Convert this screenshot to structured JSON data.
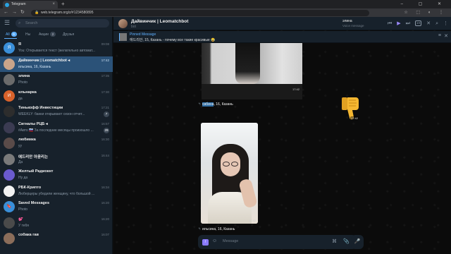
{
  "browser": {
    "tab_title": "Telegram",
    "tab_close": "×",
    "new_tab": "+",
    "window_buttons": "– ▢ ✕",
    "nav_back": "←",
    "nav_forward": "→",
    "nav_reload": "↻",
    "url": "web.telegram.org/z/#1234580895",
    "lock": "🔒",
    "extensions": "☆ ⬚ ◐ ⋮"
  },
  "sidebar": {
    "menu_icon": "☰",
    "search_icon": "⌕",
    "search_placeholder": "Search",
    "folders": [
      {
        "label": "All",
        "badge": "9"
      },
      {
        "label": "Ны",
        "badge": ""
      },
      {
        "label": "Акции",
        "badge": "2"
      },
      {
        "label": "Друзья",
        "badge": ""
      }
    ],
    "chats": [
      {
        "name": "Я",
        "preview": "You: Открывается текст (желательно автомат...",
        "time": "09:08",
        "badge": "",
        "avatar": "Я",
        "color": "#3a8fd9"
      },
      {
        "name": "Дайвинчик | Leomatchbot ◂",
        "preview": "ильсина, 16, Казань",
        "time": "17:42",
        "badge": "",
        "avatar": "",
        "color": "#c9a48a",
        "selected": true
      },
      {
        "name": "элина",
        "preview": "Photo",
        "time": "17:35",
        "badge": "",
        "avatar": "",
        "color": "#6b6b6b"
      },
      {
        "name": "ильнарка",
        "preview": "да",
        "time": "17:30",
        "badge": "",
        "avatar": "И",
        "color": "#d9622b"
      },
      {
        "name": "Тинькофф Инвестиции",
        "preview": "WEEKLY: банки открывают сезон отчет...",
        "time": "17:21",
        "badge": "7",
        "avatar": "",
        "color": "#2d2d2d"
      },
      {
        "name": "Сигналы РЦБ ◂",
        "preview": "#Авто 🇷🇺 За последние месяцы произошло ...",
        "time": "16:57",
        "badge": "29",
        "avatar": "",
        "color": "#3b3b52"
      },
      {
        "name": "любимка",
        "preview": "уу",
        "time": "16:30",
        "badge": "",
        "avatar": "",
        "color": "#5a4b49"
      },
      {
        "name": "애드리안 아윤리는",
        "preview": "Да",
        "time": "16:44",
        "badge": "",
        "avatar": "",
        "color": "#7a7a7a"
      },
      {
        "name": "Желтый Радиокнт",
        "preview": "Ну да",
        "time": "",
        "badge": "",
        "avatar": "",
        "color": "#6a5acd"
      },
      {
        "name": "РБК-Крипто",
        "preview": "Люберцеры убедили женщину, что большой ...",
        "time": "16:34",
        "badge": "",
        "avatar": "",
        "color": "#f2f2f2"
      },
      {
        "name": "Saved Messages",
        "preview": "Photo",
        "time": "16:20",
        "badge": "",
        "avatar": "🔖",
        "color": "#3a8fd9"
      },
      {
        "name": "💕",
        "preview": "У тебя",
        "time": "16:20",
        "badge": "",
        "avatar": "",
        "color": "#4a4a4a"
      },
      {
        "name": "собака гав",
        "preview": "",
        "time": "16:07",
        "badge": "",
        "avatar": "",
        "color": "#8b6d5a"
      }
    ]
  },
  "header": {
    "title": "Дайвинчик | Leomatchbot",
    "subtitle": "bot",
    "voice_name": "элина",
    "voice_sub": "Voice message",
    "icons": {
      "prev": "⏮",
      "play": "▶",
      "next": "⏭",
      "rate": "1X",
      "close": "✕",
      "search": "⌕",
      "menu": "⋮"
    }
  },
  "pinned": {
    "title": "Pinned Message",
    "text": "애드리안, 15, Казань - почему все такие красивые 😂",
    "list_icon": "≡",
    "close_icon": "✕"
  },
  "messages": {
    "photo1_caption_highlight": "сабина",
    "photo1_caption_rest": ", 16, Казань",
    "photo1_time": "17:42",
    "sticker_time": "17:42",
    "photo2_caption": "ильсина, 16, Казань",
    "photo2_time": "17:42",
    "reply_mark": "↰"
  },
  "composer": {
    "cmd_icon": "/",
    "emoji_icon": "☺",
    "placeholder": "Message",
    "command_icon": "⌘",
    "attach_icon": "📎",
    "mic_icon": "🎤"
  }
}
